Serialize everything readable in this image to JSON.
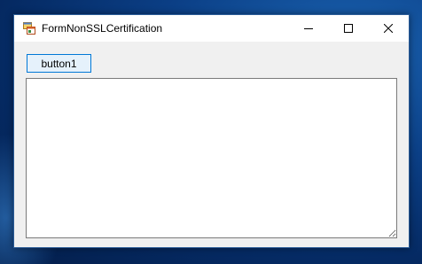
{
  "window": {
    "title": "FormNonSSLCertification",
    "icons": {
      "app": "form-app-icon",
      "minimize": "minimize-icon",
      "maximize": "maximize-icon",
      "close": "close-icon"
    },
    "colors": {
      "accent": "#0078d7",
      "client_background": "#f0f0f0",
      "titlebar_background": "#ffffff"
    }
  },
  "form": {
    "button1_label": "button1",
    "textbox_value": ""
  }
}
